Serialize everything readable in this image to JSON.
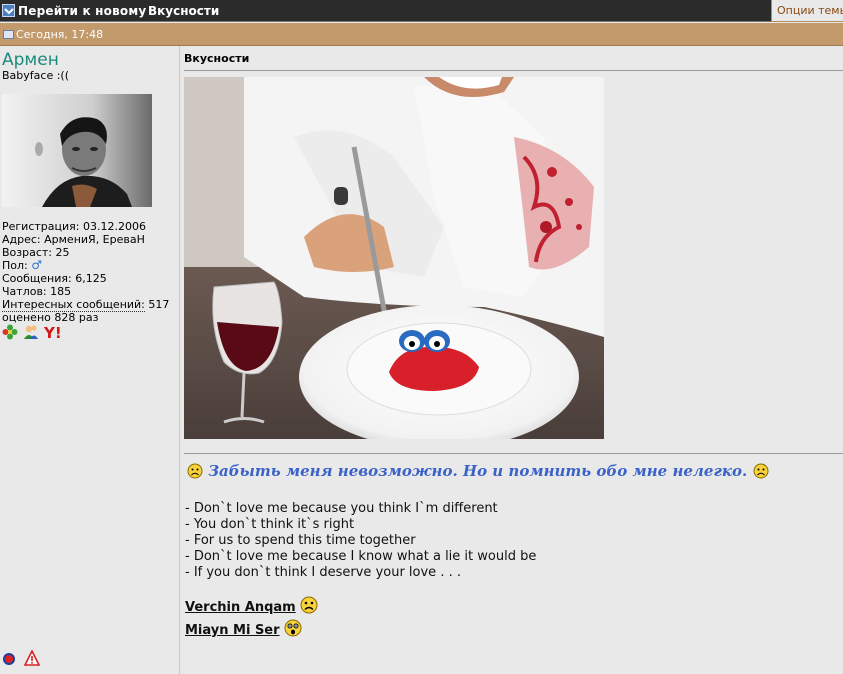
{
  "topbar": {
    "nav_label": "Перейти к новому",
    "topic_title": "Вкусности",
    "options_label": "Опции темы"
  },
  "post_header": {
    "date": "Сегодня, 17:48"
  },
  "author": {
    "name": "Армен",
    "title": "Babyface :((",
    "stats": {
      "registration": "Регистрация: 03.12.2006",
      "address": "Адрес: АрмениЯ, ЕреваН",
      "age": "Возраст: 25",
      "gender_label": "Пол:",
      "gender_icon": "male-symbol-icon",
      "posts": "Сообщения: 6,125",
      "chatlov": "Чатлов: 185",
      "interesting_label": "Интересных сообщений:",
      "interesting_count": "517",
      "rated": "оценено 828 раз"
    },
    "contact_icons": [
      "icq-icon",
      "msn-icon",
      "yahoo-icon"
    ],
    "bottom_icons": [
      "online-status-icon",
      "report-warning-icon"
    ]
  },
  "post": {
    "title": "Вкусности",
    "quote": "Забыть меня невозможно. Но и помнить обо мне нелегко.",
    "lyrics": [
      "- Don`t love me because you think I`m different",
      "- You don`t think it`s right",
      "- For us to spend this time together",
      "- Don`t love me because I know what a lie it would be",
      "- If you don`t think I deserve your love . . ."
    ],
    "signature": [
      {
        "text": "Verchin Anqam",
        "icon": "sad-smiley-icon"
      },
      {
        "text": "Miayn Mi Ser",
        "icon": "shocked-smiley-icon"
      }
    ]
  },
  "colors": {
    "topbar_bg": "#2b2b2b",
    "datebar_bg": "#c39a6c",
    "author_name": "#1c8a7a",
    "quote": "#3a62c8",
    "page_bg": "#e9e9e9"
  }
}
